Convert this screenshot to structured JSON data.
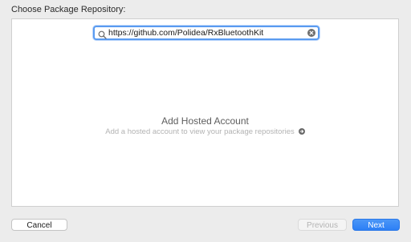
{
  "dialog": {
    "title": "Choose Package Repository:"
  },
  "search": {
    "value": "https://github.com/Polidea/RxBluetoothKit",
    "icon": "search-icon",
    "clear_icon": "clear-icon"
  },
  "empty_state": {
    "title": "Add Hosted Account",
    "subtitle": "Add a hosted account to view your package repositories",
    "action_icon": "arrow-right-circle-icon"
  },
  "buttons": {
    "cancel": "Cancel",
    "previous": "Previous",
    "next": "Next"
  },
  "colors": {
    "accent": "#2d7ff5",
    "focus_ring": "#5a9bf0",
    "window_background": "#ececec"
  }
}
